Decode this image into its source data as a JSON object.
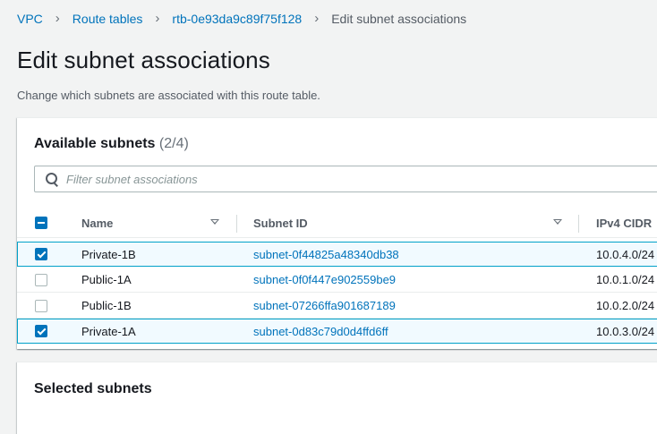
{
  "breadcrumb": {
    "items": [
      "VPC",
      "Route tables",
      "rtb-0e93da9c89f75f128"
    ],
    "current": "Edit subnet associations"
  },
  "page": {
    "title": "Edit subnet associations",
    "description": "Change which subnets are associated with this route table."
  },
  "available": {
    "title": "Available subnets",
    "count": "(2/4)",
    "filter_placeholder": "Filter subnet associations",
    "filter_value": "",
    "columns": [
      "Name",
      "Subnet ID",
      "IPv4 CIDR"
    ],
    "rows": [
      {
        "name": "Private-1B",
        "subnet_id": "subnet-0f44825a48340db38",
        "cidr": "10.0.4.0/24",
        "checked": true
      },
      {
        "name": "Public-1A",
        "subnet_id": "subnet-0f0f447e902559be9",
        "cidr": "10.0.1.0/24",
        "checked": false
      },
      {
        "name": "Public-1B",
        "subnet_id": "subnet-07266ffa901687189",
        "cidr": "10.0.2.0/24",
        "checked": false
      },
      {
        "name": "Private-1A",
        "subnet_id": "subnet-0d83c79d0d4ffd6ff",
        "cidr": "10.0.3.0/24",
        "checked": true
      }
    ]
  },
  "selected": {
    "title": "Selected subnets"
  },
  "colors": {
    "link": "#0073bb",
    "selected_row_bg": "#f1faff",
    "selected_row_border": "#00a1c9",
    "checkbox_on": "#0073bb"
  }
}
